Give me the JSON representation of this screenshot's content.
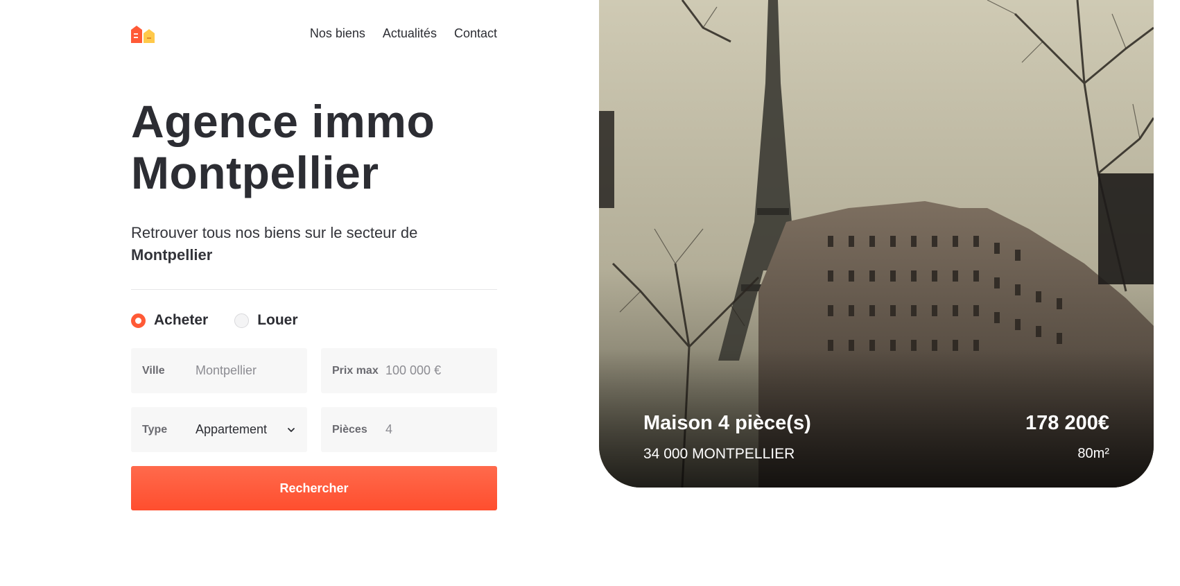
{
  "nav": {
    "items": [
      "Nos biens",
      "Actualités",
      "Contact"
    ]
  },
  "hero": {
    "title_line1": "Agence immo",
    "title_line2": "Montpellier",
    "subtitle_text": "Retrouver tous nos biens sur le secteur de",
    "subtitle_city": "Montpellier"
  },
  "search": {
    "radio_buy": "Acheter",
    "radio_rent": "Louer",
    "selected": "Acheter",
    "city_label": "Ville",
    "city_placeholder": "Montpellier",
    "price_label": "Prix max",
    "price_placeholder": "100 000 €",
    "type_label": "Type",
    "type_value": "Appartement",
    "rooms_label": "Pièces",
    "rooms_placeholder": "4",
    "submit_label": "Rechercher"
  },
  "featured": {
    "title": "Maison 4 pièce(s)",
    "location": "34 000 MONTPELLIER",
    "price": "178 200€",
    "area": "80m²"
  },
  "colors": {
    "accent": "#ff5a36",
    "text": "#2c2d33",
    "field_bg": "#f7f7f7"
  },
  "icons": {
    "logo": "house-logo-icon",
    "type_dropdown": "chevron-down-icon"
  }
}
